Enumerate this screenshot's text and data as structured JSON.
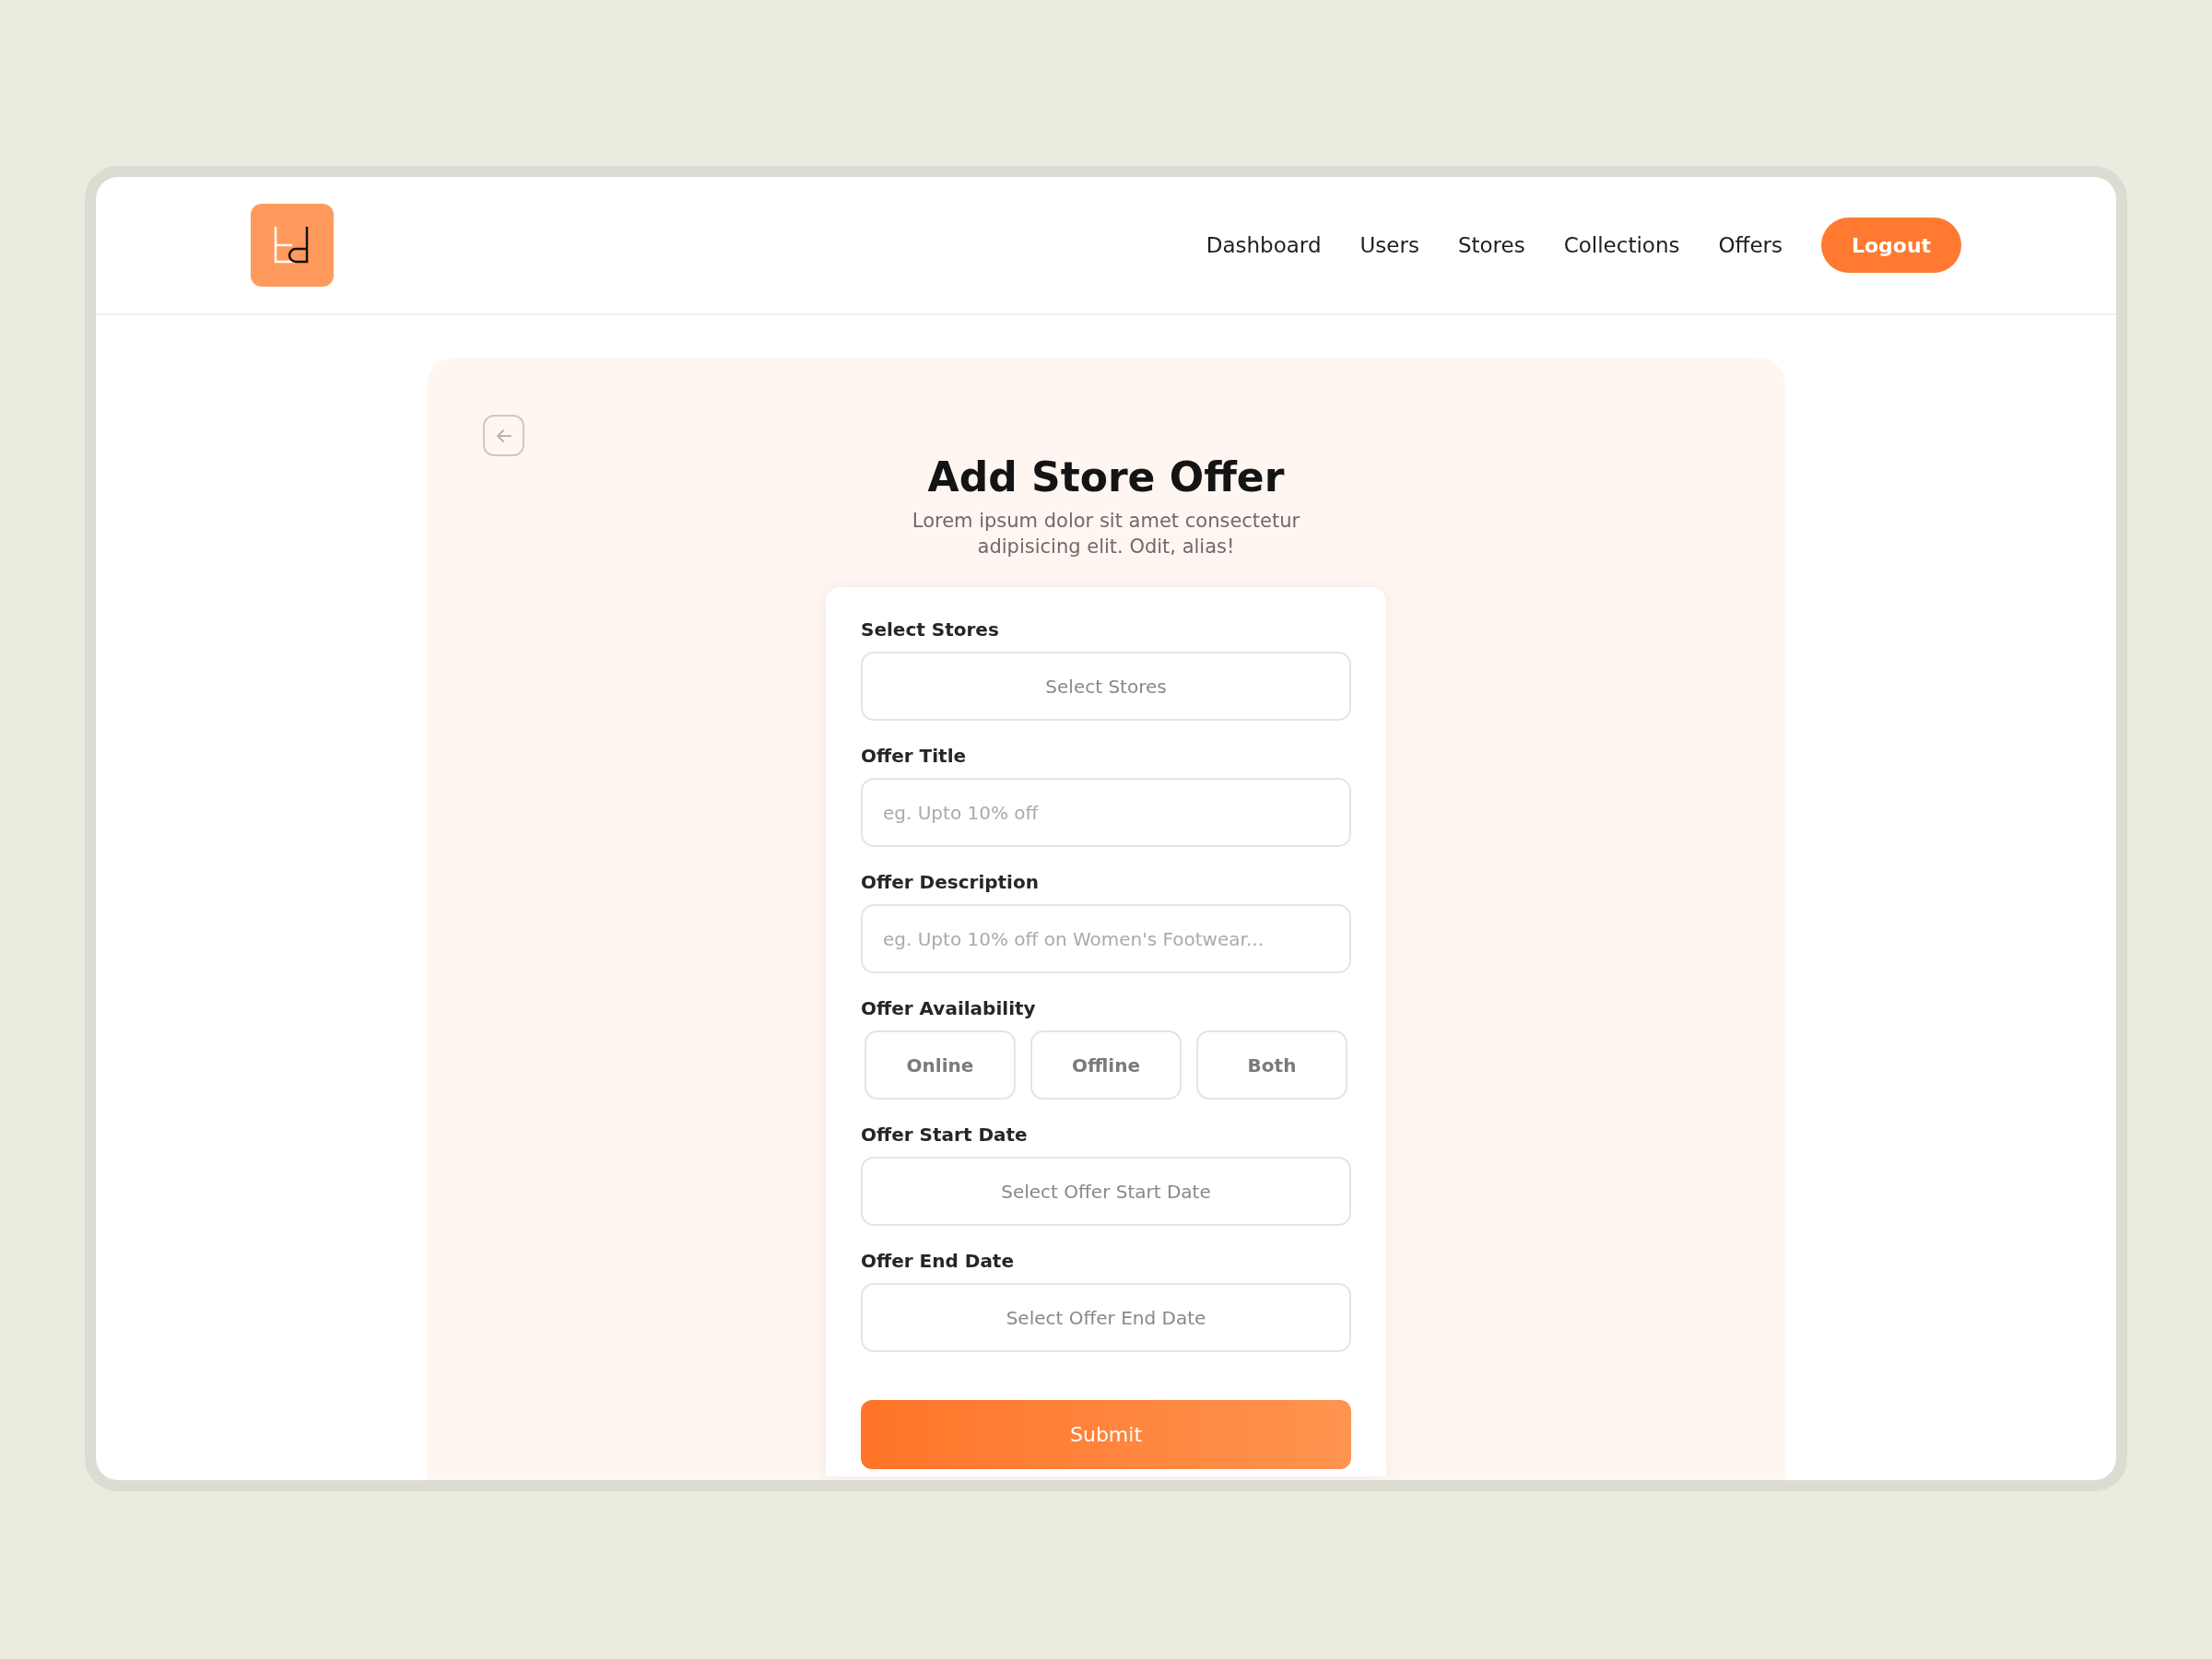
{
  "nav": {
    "items": [
      {
        "label": "Dashboard"
      },
      {
        "label": "Users"
      },
      {
        "label": "Stores"
      },
      {
        "label": "Collections"
      },
      {
        "label": "Offers"
      }
    ],
    "logout": "Logout"
  },
  "page": {
    "title": "Add Store Offer",
    "subtitle": "Lorem ipsum dolor sit amet consectetur adipisicing elit. Odit, alias!"
  },
  "form": {
    "fields": [
      {
        "kind": "select",
        "label": "Select Stores",
        "placeholder": "Select Stores"
      },
      {
        "kind": "text",
        "label": "Offer Title",
        "placeholder": "eg. Upto 10% off"
      },
      {
        "kind": "text",
        "label": "Offer Description",
        "placeholder": "eg. Upto 10% off on Women's Footwear..."
      },
      {
        "kind": "options",
        "label": "Offer Availability",
        "options": [
          {
            "label": "Online",
            "selected": false
          },
          {
            "label": "Offline",
            "selected": false
          },
          {
            "label": "Both",
            "selected": false
          }
        ]
      },
      {
        "kind": "select",
        "label": "Offer Start Date",
        "placeholder": "Select Offer Start Date"
      },
      {
        "kind": "select",
        "label": "Offer End Date",
        "placeholder": "Select Offer End Date"
      }
    ],
    "submit": "Submit"
  }
}
